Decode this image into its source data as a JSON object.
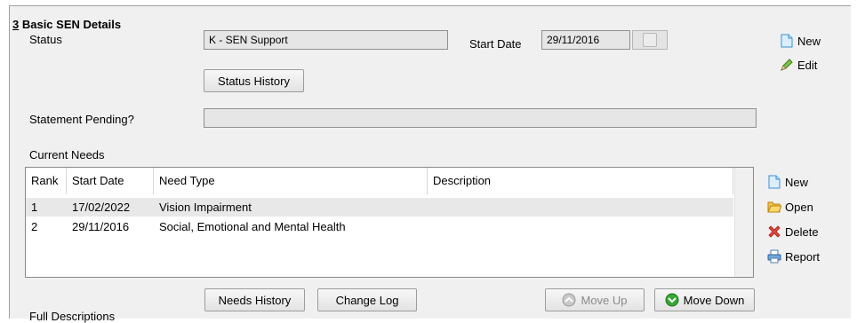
{
  "section": {
    "number": "3",
    "title": " Basic SEN Details"
  },
  "status": {
    "label": "Status",
    "value": "K - SEN Support"
  },
  "start_date": {
    "label": "Start Date",
    "value": "29/11/2016"
  },
  "status_history_button": "Status History",
  "statement_pending": {
    "label": "Statement Pending?",
    "value": ""
  },
  "top_actions": {
    "new": "New",
    "edit": "Edit"
  },
  "current_needs": {
    "label": "Current Needs",
    "columns": [
      "Rank",
      "Start Date",
      "Need Type",
      "Description"
    ],
    "rows": [
      {
        "rank": "1",
        "start_date": "17/02/2022",
        "need_type": "Vision Impairment",
        "description": ""
      },
      {
        "rank": "2",
        "start_date": "29/11/2016",
        "need_type": "Social, Emotional and Mental Health",
        "description": ""
      }
    ]
  },
  "needs_actions": {
    "new": "New",
    "open": "Open",
    "delete": "Delete",
    "report": "Report"
  },
  "bottom_buttons": {
    "needs_history": "Needs History",
    "change_log": "Change Log",
    "move_up": "Move Up",
    "move_down": "Move Down"
  },
  "next_section_label": "Full Descriptions",
  "colors": {
    "panel_bg": "#f0f0f0",
    "selected_row": "#e8e8e8",
    "doc_blue": "#3a8fd8",
    "delete_red": "#d9261c",
    "move_green": "#2e9e2e"
  }
}
